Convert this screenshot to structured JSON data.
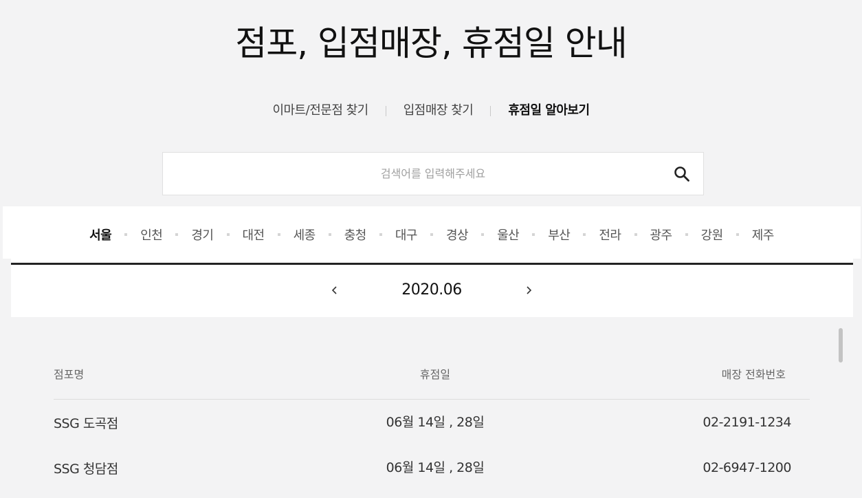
{
  "page": {
    "title": "점포, 입점매장, 휴점일 안내"
  },
  "tabs": [
    {
      "label": "이마트/전문점 찾기",
      "active": false
    },
    {
      "label": "입점매장 찾기",
      "active": false
    },
    {
      "label": "휴점일 알아보기",
      "active": true
    }
  ],
  "search": {
    "placeholder": "검색어를 입력해주세요",
    "value": "",
    "icon": "search-icon"
  },
  "regions": [
    {
      "label": "서울",
      "active": true
    },
    {
      "label": "인천",
      "active": false
    },
    {
      "label": "경기",
      "active": false
    },
    {
      "label": "대전",
      "active": false
    },
    {
      "label": "세종",
      "active": false
    },
    {
      "label": "충청",
      "active": false
    },
    {
      "label": "대구",
      "active": false
    },
    {
      "label": "경상",
      "active": false
    },
    {
      "label": "울산",
      "active": false
    },
    {
      "label": "부산",
      "active": false
    },
    {
      "label": "전라",
      "active": false
    },
    {
      "label": "광주",
      "active": false
    },
    {
      "label": "강원",
      "active": false
    },
    {
      "label": "제주",
      "active": false
    }
  ],
  "month_nav": {
    "current": "2020.06",
    "prev_icon": "chevron-left-icon",
    "next_icon": "chevron-right-icon"
  },
  "table": {
    "headers": {
      "name": "점포명",
      "closed": "휴점일",
      "phone": "매장 전화번호"
    },
    "rows": [
      {
        "name": "SSG 도곡점",
        "closed": "06월 14일 , 28일",
        "phone": "02-2191-1234"
      },
      {
        "name": "SSG 청담점",
        "closed": "06월 14일 , 28일",
        "phone": "02-6947-1200"
      }
    ]
  }
}
